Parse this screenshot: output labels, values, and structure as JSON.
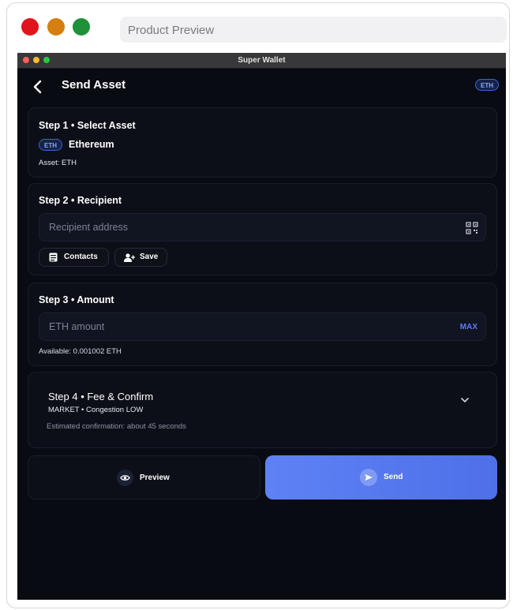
{
  "browser": {
    "address_text": "Product Preview"
  },
  "window": {
    "title": "Super Wallet"
  },
  "header": {
    "title": "Send Asset",
    "badge": "ETH"
  },
  "step1": {
    "title": "Step 1 • Select Asset",
    "asset_badge": "ETH",
    "asset_name": "Ethereum",
    "asset_line": "Asset: ETH"
  },
  "step2": {
    "title": "Step 2 • Recipient",
    "placeholder": "Recipient address",
    "contacts_label": "Contacts",
    "save_label": "Save"
  },
  "step3": {
    "title": "Step 3 • Amount",
    "placeholder": "ETH amount",
    "max_label": "MAX",
    "available": "Available: 0.001002 ETH"
  },
  "step4": {
    "title": "Step 4 • Fee & Confirm",
    "subtitle": "MARKET • Congestion LOW",
    "estimate": "Estimated confirmation: about 45 seconds"
  },
  "actions": {
    "preview_label": "Preview",
    "send_label": "Send"
  },
  "colors": {
    "accent": "#5b7ef5",
    "background": "#090b12",
    "card": "#0d0f18",
    "badge_border": "#3c62d9"
  }
}
